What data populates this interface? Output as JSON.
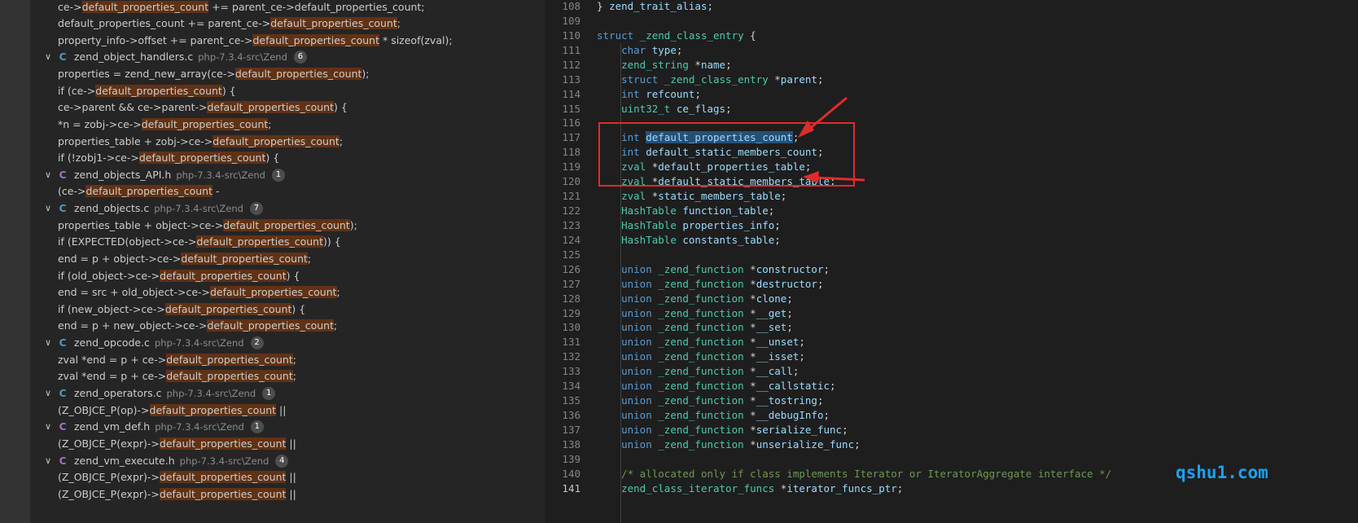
{
  "search_results": [
    {
      "kind": "match",
      "pre": "ce->",
      "hl": "default_properties_count",
      "post": " += parent_ce->default_properties_count;"
    },
    {
      "kind": "match",
      "pre": "default_properties_count += parent_ce->",
      "hl": "default_properties_count",
      "post": ";"
    },
    {
      "kind": "match",
      "pre": "property_info->offset += parent_ce->",
      "hl": "default_properties_count",
      "post": " * sizeof(zval);"
    },
    {
      "kind": "file",
      "type": "C",
      "name": "zend_object_handlers.c",
      "path": "php-7.3.4-src\\Zend",
      "count": "6"
    },
    {
      "kind": "match",
      "pre": "properties = zend_new_array(ce->",
      "hl": "default_properties_count",
      "post": ");"
    },
    {
      "kind": "match",
      "pre": "if (ce->",
      "hl": "default_properties_count",
      "post": ") {"
    },
    {
      "kind": "match",
      "pre": "ce->parent && ce->parent->",
      "hl": "default_properties_count",
      "post": ") {"
    },
    {
      "kind": "match",
      "pre": "*n = zobj->ce->",
      "hl": "default_properties_count",
      "post": ";"
    },
    {
      "kind": "match",
      "pre": "properties_table + zobj->ce->",
      "hl": "default_properties_count",
      "post": ";"
    },
    {
      "kind": "match",
      "pre": "if (!zobj1->ce->",
      "hl": "default_properties_count",
      "post": ") {"
    },
    {
      "kind": "file",
      "type": "C",
      "name": "zend_objects_API.h",
      "path": "php-7.3.4-src\\Zend",
      "count": "1"
    },
    {
      "kind": "match",
      "pre": "(ce->",
      "hl": "default_properties_count",
      "post": " -"
    },
    {
      "kind": "file",
      "type": "C",
      "name": "zend_objects.c",
      "path": "php-7.3.4-src\\Zend",
      "count": "7"
    },
    {
      "kind": "match",
      "pre": "properties_table + object->ce->",
      "hl": "default_properties_count",
      "post": ");"
    },
    {
      "kind": "match",
      "pre": "if (EXPECTED(object->ce->",
      "hl": "default_properties_count",
      "post": ")) {"
    },
    {
      "kind": "match",
      "pre": "end = p + object->ce->",
      "hl": "default_properties_count",
      "post": ";"
    },
    {
      "kind": "match",
      "pre": "if (old_object->ce->",
      "hl": "default_properties_count",
      "post": ") {"
    },
    {
      "kind": "match",
      "pre": "end = src + old_object->ce->",
      "hl": "default_properties_count",
      "post": ";"
    },
    {
      "kind": "match",
      "pre": "if (new_object->ce->",
      "hl": "default_properties_count",
      "post": ") {"
    },
    {
      "kind": "match",
      "pre": "end = p + new_object->ce->",
      "hl": "default_properties_count",
      "post": ";"
    },
    {
      "kind": "file",
      "type": "C",
      "name": "zend_opcode.c",
      "path": "php-7.3.4-src\\Zend",
      "count": "2"
    },
    {
      "kind": "match",
      "pre": "zval *end = p + ce->",
      "hl": "default_properties_count",
      "post": ";"
    },
    {
      "kind": "match",
      "pre": "zval *end = p + ce->",
      "hl": "default_properties_count",
      "post": ";"
    },
    {
      "kind": "file",
      "type": "C",
      "name": "zend_operators.c",
      "path": "php-7.3.4-src\\Zend",
      "count": "1"
    },
    {
      "kind": "match",
      "pre": "(Z_OBJCE_P(op)->",
      "hl": "default_properties_count",
      "post": " ||"
    },
    {
      "kind": "file",
      "type": "C",
      "name": "zend_vm_def.h",
      "path": "php-7.3.4-src\\Zend",
      "count": "1"
    },
    {
      "kind": "match",
      "pre": "(Z_OBJCE_P(expr)->",
      "hl": "default_properties_count",
      "post": " ||"
    },
    {
      "kind": "file",
      "type": "C",
      "name": "zend_vm_execute.h",
      "path": "php-7.3.4-src\\Zend",
      "count": "4"
    },
    {
      "kind": "match",
      "pre": "(Z_OBJCE_P(expr)->",
      "hl": "default_properties_count",
      "post": " ||"
    },
    {
      "kind": "match",
      "pre": "(Z_OBJCE_P(expr)->",
      "hl": "default_properties_count",
      "post": " ||"
    }
  ],
  "code_lines": [
    {
      "n": "108",
      "t": [
        [
          "p",
          "} "
        ],
        [
          "va",
          "zend_trait_alias"
        ],
        [
          "p",
          ";"
        ]
      ]
    },
    {
      "n": "109",
      "t": []
    },
    {
      "n": "110",
      "t": [
        [
          "kw",
          "struct"
        ],
        [
          "p",
          " "
        ],
        [
          "ty",
          "_zend_class_entry"
        ],
        [
          "p",
          " {"
        ]
      ]
    },
    {
      "n": "111",
      "t": [
        [
          "p",
          "    "
        ],
        [
          "kw",
          "char"
        ],
        [
          "p",
          " "
        ],
        [
          "va",
          "type"
        ],
        [
          "p",
          ";"
        ]
      ]
    },
    {
      "n": "112",
      "t": [
        [
          "p",
          "    "
        ],
        [
          "ty",
          "zend_string"
        ],
        [
          "p",
          " *"
        ],
        [
          "va",
          "name"
        ],
        [
          "p",
          ";"
        ]
      ]
    },
    {
      "n": "113",
      "t": [
        [
          "p",
          "    "
        ],
        [
          "kw",
          "struct"
        ],
        [
          "p",
          " "
        ],
        [
          "ty",
          "_zend_class_entry"
        ],
        [
          "p",
          " *"
        ],
        [
          "va",
          "parent"
        ],
        [
          "p",
          ";"
        ]
      ]
    },
    {
      "n": "114",
      "t": [
        [
          "p",
          "    "
        ],
        [
          "kw",
          "int"
        ],
        [
          "p",
          " "
        ],
        [
          "va",
          "refcount"
        ],
        [
          "p",
          ";"
        ]
      ]
    },
    {
      "n": "115",
      "t": [
        [
          "p",
          "    "
        ],
        [
          "ty",
          "uint32_t"
        ],
        [
          "p",
          " "
        ],
        [
          "va",
          "ce_flags"
        ],
        [
          "p",
          ";"
        ]
      ]
    },
    {
      "n": "116",
      "t": []
    },
    {
      "n": "117",
      "t": [
        [
          "p",
          "    "
        ],
        [
          "kw",
          "int"
        ],
        [
          "p",
          " "
        ],
        [
          "sel",
          "default_properties_count"
        ],
        [
          "p",
          ";"
        ]
      ]
    },
    {
      "n": "118",
      "t": [
        [
          "p",
          "    "
        ],
        [
          "kw",
          "int"
        ],
        [
          "p",
          " "
        ],
        [
          "va",
          "default_static_members_count"
        ],
        [
          "p",
          ";"
        ]
      ]
    },
    {
      "n": "119",
      "t": [
        [
          "p",
          "    "
        ],
        [
          "ty",
          "zval"
        ],
        [
          "p",
          " *"
        ],
        [
          "va",
          "default_properties_table"
        ],
        [
          "p",
          ";"
        ]
      ]
    },
    {
      "n": "120",
      "t": [
        [
          "p",
          "    "
        ],
        [
          "ty",
          "zval"
        ],
        [
          "p",
          " *"
        ],
        [
          "va",
          "default_static_members_table"
        ],
        [
          "p",
          ";"
        ]
      ]
    },
    {
      "n": "121",
      "t": [
        [
          "p",
          "    "
        ],
        [
          "ty",
          "zval"
        ],
        [
          "p",
          " *"
        ],
        [
          "va",
          "static_members_table"
        ],
        [
          "p",
          ";"
        ]
      ]
    },
    {
      "n": "122",
      "t": [
        [
          "p",
          "    "
        ],
        [
          "ty",
          "HashTable"
        ],
        [
          "p",
          " "
        ],
        [
          "va",
          "function_table"
        ],
        [
          "p",
          ";"
        ]
      ]
    },
    {
      "n": "123",
      "t": [
        [
          "p",
          "    "
        ],
        [
          "ty",
          "HashTable"
        ],
        [
          "p",
          " "
        ],
        [
          "va",
          "properties_info"
        ],
        [
          "p",
          ";"
        ]
      ]
    },
    {
      "n": "124",
      "t": [
        [
          "p",
          "    "
        ],
        [
          "ty",
          "HashTable"
        ],
        [
          "p",
          " "
        ],
        [
          "va",
          "constants_table"
        ],
        [
          "p",
          ";"
        ]
      ]
    },
    {
      "n": "125",
      "t": []
    },
    {
      "n": "126",
      "t": [
        [
          "p",
          "    "
        ],
        [
          "kw",
          "union"
        ],
        [
          "p",
          " "
        ],
        [
          "ty",
          "_zend_function"
        ],
        [
          "p",
          " *"
        ],
        [
          "va",
          "constructor"
        ],
        [
          "p",
          ";"
        ]
      ]
    },
    {
      "n": "127",
      "t": [
        [
          "p",
          "    "
        ],
        [
          "kw",
          "union"
        ],
        [
          "p",
          " "
        ],
        [
          "ty",
          "_zend_function"
        ],
        [
          "p",
          " *"
        ],
        [
          "va",
          "destructor"
        ],
        [
          "p",
          ";"
        ]
      ]
    },
    {
      "n": "128",
      "t": [
        [
          "p",
          "    "
        ],
        [
          "kw",
          "union"
        ],
        [
          "p",
          " "
        ],
        [
          "ty",
          "_zend_function"
        ],
        [
          "p",
          " *"
        ],
        [
          "va",
          "clone"
        ],
        [
          "p",
          ";"
        ]
      ]
    },
    {
      "n": "129",
      "t": [
        [
          "p",
          "    "
        ],
        [
          "kw",
          "union"
        ],
        [
          "p",
          " "
        ],
        [
          "ty",
          "_zend_function"
        ],
        [
          "p",
          " *"
        ],
        [
          "va",
          "__get"
        ],
        [
          "p",
          ";"
        ]
      ]
    },
    {
      "n": "130",
      "t": [
        [
          "p",
          "    "
        ],
        [
          "kw",
          "union"
        ],
        [
          "p",
          " "
        ],
        [
          "ty",
          "_zend_function"
        ],
        [
          "p",
          " *"
        ],
        [
          "va",
          "__set"
        ],
        [
          "p",
          ";"
        ]
      ]
    },
    {
      "n": "131",
      "t": [
        [
          "p",
          "    "
        ],
        [
          "kw",
          "union"
        ],
        [
          "p",
          " "
        ],
        [
          "ty",
          "_zend_function"
        ],
        [
          "p",
          " *"
        ],
        [
          "va",
          "__unset"
        ],
        [
          "p",
          ";"
        ]
      ]
    },
    {
      "n": "132",
      "t": [
        [
          "p",
          "    "
        ],
        [
          "kw",
          "union"
        ],
        [
          "p",
          " "
        ],
        [
          "ty",
          "_zend_function"
        ],
        [
          "p",
          " *"
        ],
        [
          "va",
          "__isset"
        ],
        [
          "p",
          ";"
        ]
      ]
    },
    {
      "n": "133",
      "t": [
        [
          "p",
          "    "
        ],
        [
          "kw",
          "union"
        ],
        [
          "p",
          " "
        ],
        [
          "ty",
          "_zend_function"
        ],
        [
          "p",
          " *"
        ],
        [
          "va",
          "__call"
        ],
        [
          "p",
          ";"
        ]
      ]
    },
    {
      "n": "134",
      "t": [
        [
          "p",
          "    "
        ],
        [
          "kw",
          "union"
        ],
        [
          "p",
          " "
        ],
        [
          "ty",
          "_zend_function"
        ],
        [
          "p",
          " *"
        ],
        [
          "va",
          "__callstatic"
        ],
        [
          "p",
          ";"
        ]
      ]
    },
    {
      "n": "135",
      "t": [
        [
          "p",
          "    "
        ],
        [
          "kw",
          "union"
        ],
        [
          "p",
          " "
        ],
        [
          "ty",
          "_zend_function"
        ],
        [
          "p",
          " *"
        ],
        [
          "va",
          "__tostring"
        ],
        [
          "p",
          ";"
        ]
      ]
    },
    {
      "n": "136",
      "t": [
        [
          "p",
          "    "
        ],
        [
          "kw",
          "union"
        ],
        [
          "p",
          " "
        ],
        [
          "ty",
          "_zend_function"
        ],
        [
          "p",
          " *"
        ],
        [
          "va",
          "__debugInfo"
        ],
        [
          "p",
          ";"
        ]
      ]
    },
    {
      "n": "137",
      "t": [
        [
          "p",
          "    "
        ],
        [
          "kw",
          "union"
        ],
        [
          "p",
          " "
        ],
        [
          "ty",
          "_zend_function"
        ],
        [
          "p",
          " *"
        ],
        [
          "va",
          "serialize_func"
        ],
        [
          "p",
          ";"
        ]
      ]
    },
    {
      "n": "138",
      "t": [
        [
          "p",
          "    "
        ],
        [
          "kw",
          "union"
        ],
        [
          "p",
          " "
        ],
        [
          "ty",
          "_zend_function"
        ],
        [
          "p",
          " *"
        ],
        [
          "va",
          "unserialize_func"
        ],
        [
          "p",
          ";"
        ]
      ]
    },
    {
      "n": "139",
      "t": []
    },
    {
      "n": "140",
      "t": [
        [
          "p",
          "    "
        ],
        [
          "cm",
          "/* allocated only if class implements Iterator or IteratorAggregate interface */"
        ]
      ]
    },
    {
      "n": "141",
      "t": [
        [
          "p",
          "    "
        ],
        [
          "ty",
          "zend_class_iterator_funcs"
        ],
        [
          "p",
          " *"
        ],
        [
          "va",
          "iterator_funcs_ptr"
        ],
        [
          "p",
          ";"
        ]
      ]
    }
  ],
  "current_line": "141",
  "watermark": "qshu1.com",
  "colors": {
    "match_highlight": "#613214",
    "annotation_red": "#e12b2b",
    "watermark_blue": "#1aa2f0"
  }
}
